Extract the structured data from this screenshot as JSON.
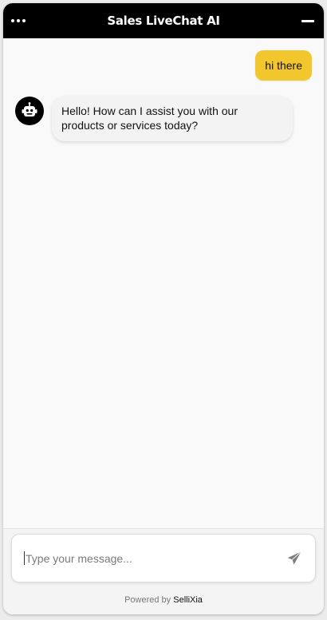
{
  "header": {
    "title": "Sales LiveChat AI",
    "menu_icon": "ellipsis-icon",
    "minimize_icon": "minimize-icon",
    "background": "#000000"
  },
  "messages": [
    {
      "sender": "user",
      "text": "hi there",
      "bubble_color": "#f2c72e"
    },
    {
      "sender": "bot",
      "avatar_icon": "robot-icon",
      "text": "Hello! How can I assist you with our products or services today?"
    }
  ],
  "composer": {
    "placeholder": "Type your message...",
    "send_icon": "paper-plane-icon"
  },
  "footer": {
    "powered_prefix": "Powered by",
    "brand": "SelliXia"
  }
}
